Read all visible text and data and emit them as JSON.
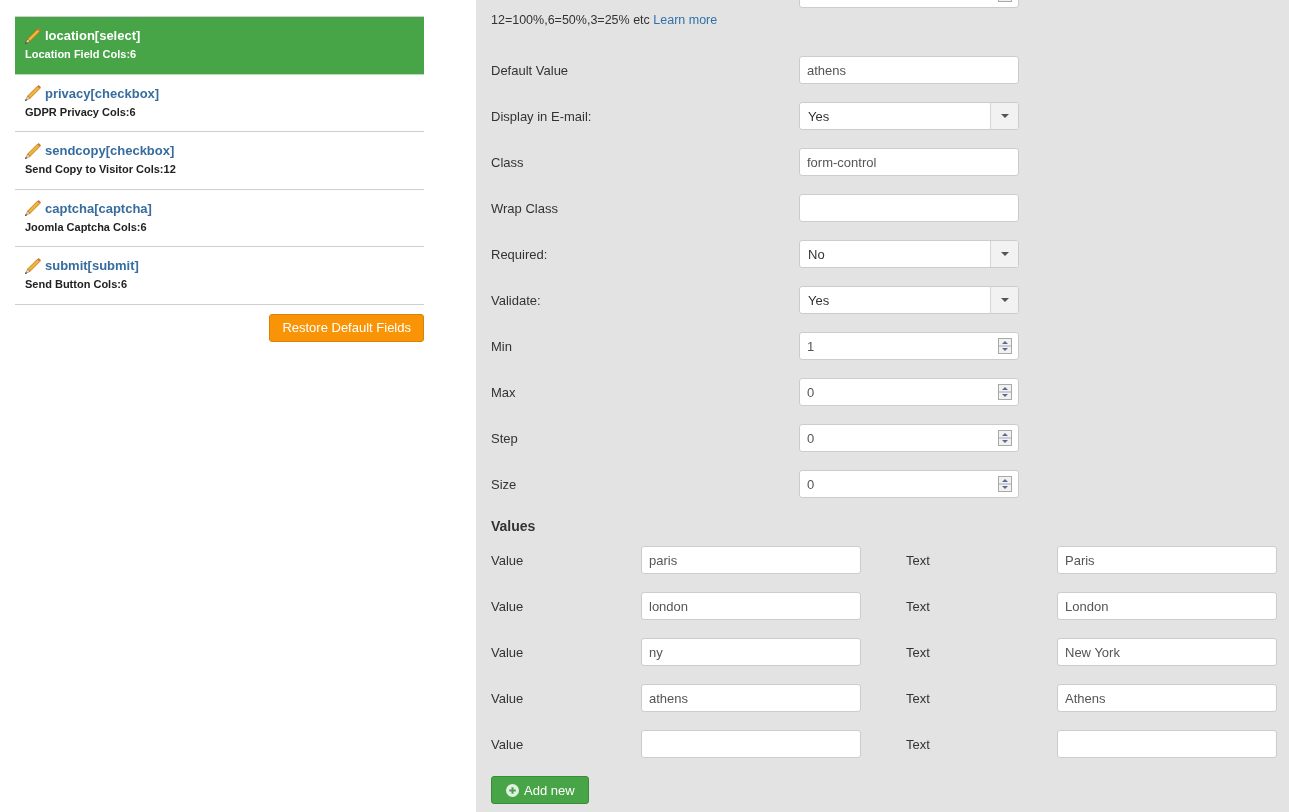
{
  "field_list": {
    "items": [
      {
        "title": "location[select]",
        "subtitle": "Location Field Cols:6",
        "selected": true
      },
      {
        "title": "privacy[checkbox]",
        "subtitle": "GDPR Privacy Cols:6",
        "selected": false
      },
      {
        "title": "sendcopy[checkbox]",
        "subtitle": "Send Copy to Visitor Cols:12",
        "selected": false
      },
      {
        "title": "captcha[captcha]",
        "subtitle": "Joomla Captcha Cols:6",
        "selected": false
      },
      {
        "title": "submit[submit]",
        "subtitle": "Send Button Cols:6",
        "selected": false
      }
    ],
    "restore_button": "Restore Default Fields"
  },
  "field_settings": {
    "rows": [
      {
        "kind": "number",
        "help": "12=100%,6=50%,3=25% etc",
        "help_link": "Learn more"
      },
      {
        "label": "Default Value",
        "kind": "text",
        "value": "athens"
      },
      {
        "label": "Display in E-mail:",
        "kind": "select",
        "value": "Yes"
      },
      {
        "label": "Class",
        "kind": "text",
        "value": "form-control"
      },
      {
        "label": "Wrap Class",
        "kind": "text"
      },
      {
        "label": "Required:",
        "kind": "select",
        "value": "No"
      },
      {
        "label": "Validate:",
        "kind": "select",
        "value": "Yes"
      },
      {
        "label": "Min",
        "kind": "number",
        "value": "1"
      },
      {
        "label": "Max",
        "kind": "number",
        "value": "0"
      },
      {
        "label": "Step",
        "kind": "number",
        "value": "0"
      },
      {
        "label": "Size",
        "kind": "number",
        "value": "0"
      }
    ]
  },
  "values": {
    "heading": "Values",
    "rows": [
      {
        "value_label": "Value",
        "value": "paris",
        "text_label": "Text",
        "text": "Paris"
      },
      {
        "value_label": "Value",
        "value": "london",
        "text_label": "Text",
        "text": "London"
      },
      {
        "value_label": "Value",
        "value": "ny",
        "text_label": "Text",
        "text": "New York"
      },
      {
        "value_label": "Value",
        "value": "athens",
        "text_label": "Text",
        "text": "Athens"
      },
      {
        "value_label": "Value",
        "text_label": "Text"
      }
    ],
    "add_button": "Add new"
  }
}
